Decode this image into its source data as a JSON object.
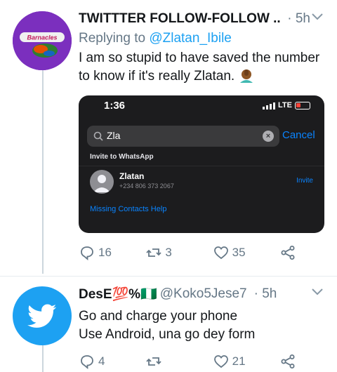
{
  "tweets": [
    {
      "avatar_text": "Barnacles",
      "name": "TWITTTER FOLLOW-FOLLOW ...",
      "time": "· 5h",
      "replying_prefix": "Replying to",
      "replying_to": "@Zlatan_Ibile",
      "text": "I am so stupid to have saved the number to know if it's really Zlatan.",
      "media": {
        "time": "1:36",
        "network": "LTE",
        "search_value": "Zla",
        "cancel_label": "Cancel",
        "section_label": "Invite to WhatsApp",
        "contact_name": "Zlatan",
        "contact_phone": "+234 806 373 2067",
        "invite_label": "Invite",
        "help_label": "Missing Contacts Help"
      },
      "counts": {
        "replies": "16",
        "retweets": "3",
        "likes": "35"
      }
    },
    {
      "name": "DesE💯%🇳🇬",
      "handle": "@Koko5Jese7",
      "time": "· 5h",
      "line1": "Go and charge your phone",
      "line2": "Use Android, una go dey form",
      "counts": {
        "replies": "4",
        "retweets": "",
        "likes": "21"
      }
    }
  ],
  "colors": {
    "accent": "#1da1f2",
    "muted": "#657786",
    "text": "#14171a",
    "media_bg": "#1c1c1e",
    "ios_blue": "#0a84ff",
    "avatar1_bg": "#7b2fbe"
  },
  "icons": [
    "chevron-down-icon",
    "reply-icon",
    "retweet-icon",
    "like-icon",
    "share-icon",
    "twitter-bird-icon",
    "facepalm-emoji"
  ]
}
